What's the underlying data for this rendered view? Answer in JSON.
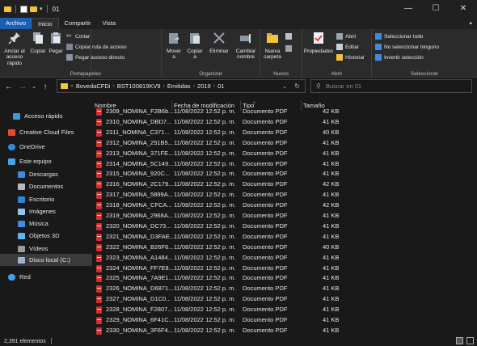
{
  "window": {
    "title": "01",
    "minimize": "—",
    "maximize": "☐",
    "close": "✕"
  },
  "ribbon_tabs": [
    "Archivo",
    "Inicio",
    "Compartir",
    "Vista"
  ],
  "ribbon": {
    "portapapeles": {
      "caption": "Portapapeles",
      "anclar": "Anclar al acceso rápido",
      "anclar_l1": "Anclar al",
      "anclar_l2": "acceso rápido",
      "copiar": "Copiar",
      "pegar": "Pegar",
      "cortar": "Cortar",
      "copiar_ruta": "Copiar ruta de acceso",
      "pegar_directo": "Pegar acceso directo"
    },
    "organizar": {
      "caption": "Organizar",
      "mover_l1": "Mover",
      "mover_l2": "a",
      "copiar_l1": "Copiar",
      "copiar_l2": "a",
      "eliminar_l1": "Eliminar",
      "eliminar_l2": "",
      "cambiar_l1": "Cambiar",
      "cambiar_l2": "nombre"
    },
    "nuevo": {
      "caption": "Nuevo",
      "nueva_l1": "Nueva",
      "nueva_l2": "carpeta"
    },
    "abrir": {
      "caption": "Abrir",
      "propiedades": "Propiedades",
      "abrir": "Abrir",
      "editar": "Editar",
      "historial": "Historial"
    },
    "seleccionar": {
      "caption": "Seleccionar",
      "todo": "Seleccionar todo",
      "ninguno": "No seleccionar ninguno",
      "invertir": "Invertir selección"
    }
  },
  "address": {
    "back": "←",
    "forward": "→",
    "recent": "⌄",
    "up": "↑",
    "overflow": "«",
    "crumbs": [
      "BovedaCFDi",
      "BST100819KV9",
      "Emitidas",
      "2019",
      "01"
    ],
    "search_placeholder": "Buscar en 01"
  },
  "nav": [
    {
      "label": "Acceso rápido",
      "icon": "star-icon",
      "color": "#3a9bdc"
    },
    {
      "label": "Creative Cloud Files",
      "icon": "creative-cloud-icon",
      "color": "#e8492e"
    },
    {
      "label": "OneDrive",
      "icon": "cloud-icon",
      "color": "#2d8cdc"
    },
    {
      "label": "Este equipo",
      "icon": "computer-icon",
      "color": "#4aa3e6"
    },
    {
      "label": "Descargas",
      "icon": "download-icon",
      "color": "#3d8bdc"
    },
    {
      "label": "Documentos",
      "icon": "documents-icon",
      "color": "#b9b9b9"
    },
    {
      "label": "Escritorio",
      "icon": "desktop-icon",
      "color": "#2e86d9"
    },
    {
      "label": "Imágenes",
      "icon": "pictures-icon",
      "color": "#8ec5f0"
    },
    {
      "label": "Música",
      "icon": "music-icon",
      "color": "#3e8fe0"
    },
    {
      "label": "Objetos 3D",
      "icon": "objects3d-icon",
      "color": "#5fb3f0"
    },
    {
      "label": "Vídeos",
      "icon": "videos-icon",
      "color": "#9a9a9a"
    },
    {
      "label": "Disco local (C:)",
      "icon": "drive-icon",
      "color": "#9ab6cf"
    },
    {
      "label": "Red",
      "icon": "network-icon",
      "color": "#4a9ee6"
    }
  ],
  "columns": {
    "name": "Nombre",
    "modified": "Fecha de modificación",
    "type": "Tipo",
    "size": "Tamaño"
  },
  "files": [
    {
      "name": "2309_NOMINA_F2B6b...",
      "modified": "11/08/2022 12:52 p. m.",
      "type": "Documento PDF",
      "size": "42 KB"
    },
    {
      "name": "2310_NOMINA_DBD7...",
      "modified": "11/08/2022 12:52 p. m.",
      "type": "Documento PDF",
      "size": "41 KB"
    },
    {
      "name": "2311_NOMINA_C371...",
      "modified": "11/08/2022 12:52 p. m.",
      "type": "Documento PDF",
      "size": "40 KB"
    },
    {
      "name": "2312_NOMINA_251B5...",
      "modified": "11/08/2022 12:52 p. m.",
      "type": "Documento PDF",
      "size": "41 KB"
    },
    {
      "name": "2313_NOMINA_371FE...",
      "modified": "11/08/2022 12:52 p. m.",
      "type": "Documento PDF",
      "size": "41 KB"
    },
    {
      "name": "2314_NOMINA_5C149...",
      "modified": "11/08/2022 12:52 p. m.",
      "type": "Documento PDF",
      "size": "41 KB"
    },
    {
      "name": "2315_NOMINA_920C...",
      "modified": "11/08/2022 12:52 p. m.",
      "type": "Documento PDF",
      "size": "41 KB"
    },
    {
      "name": "2316_NOMINA_2C179...",
      "modified": "11/08/2022 12:52 p. m.",
      "type": "Documento PDF",
      "size": "42 KB"
    },
    {
      "name": "2317_NOMINA_5899A...",
      "modified": "11/08/2022 12:52 p. m.",
      "type": "Documento PDF",
      "size": "41 KB"
    },
    {
      "name": "2318_NOMINA_CFCA...",
      "modified": "11/08/2022 12:52 p. m.",
      "type": "Documento PDF",
      "size": "42 KB"
    },
    {
      "name": "2319_NOMINA_2968A...",
      "modified": "11/08/2022 12:52 p. m.",
      "type": "Documento PDF",
      "size": "41 KB"
    },
    {
      "name": "2320_NOMINA_DC73...",
      "modified": "11/08/2022 12:52 p. m.",
      "type": "Documento PDF",
      "size": "41 KB"
    },
    {
      "name": "2321_NOMINA_D3FAE...",
      "modified": "11/08/2022 12:52 p. m.",
      "type": "Documento PDF",
      "size": "41 KB"
    },
    {
      "name": "2322_NOMINA_B26F6...",
      "modified": "11/08/2022 12:52 p. m.",
      "type": "Documento PDF",
      "size": "40 KB"
    },
    {
      "name": "2323_NOMINA_A1484...",
      "modified": "11/08/2022 12:52 p. m.",
      "type": "Documento PDF",
      "size": "41 KB"
    },
    {
      "name": "2324_NOMINA_FF7E8...",
      "modified": "11/08/2022 12:52 p. m.",
      "type": "Documento PDF",
      "size": "41 KB"
    },
    {
      "name": "2325_NOMINA_7A9E1...",
      "modified": "11/08/2022 12:52 p. m.",
      "type": "Documento PDF",
      "size": "41 KB"
    },
    {
      "name": "2326_NOMINA_D6871...",
      "modified": "11/08/2022 12:52 p. m.",
      "type": "Documento PDF",
      "size": "41 KB"
    },
    {
      "name": "2327_NOMINA_D1C0...",
      "modified": "11/08/2022 12:52 p. m.",
      "type": "Documento PDF",
      "size": "41 KB"
    },
    {
      "name": "2328_NOMINA_F2807...",
      "modified": "11/08/2022 12:52 p. m.",
      "type": "Documento PDF",
      "size": "41 KB"
    },
    {
      "name": "2329_NOMINA_6F41C...",
      "modified": "11/08/2022 12:52 p. m.",
      "type": "Documento PDF",
      "size": "41 KB"
    },
    {
      "name": "2330_NOMINA_3F6F4...",
      "modified": "11/08/2022 12:52 p. m.",
      "type": "Documento PDF",
      "size": "41 KB"
    }
  ],
  "status": {
    "count": "2,391 elementos"
  },
  "colors": {
    "accent": "#1a5fb4",
    "folder": "#f3c33b",
    "pdf": "#d32f2f"
  }
}
